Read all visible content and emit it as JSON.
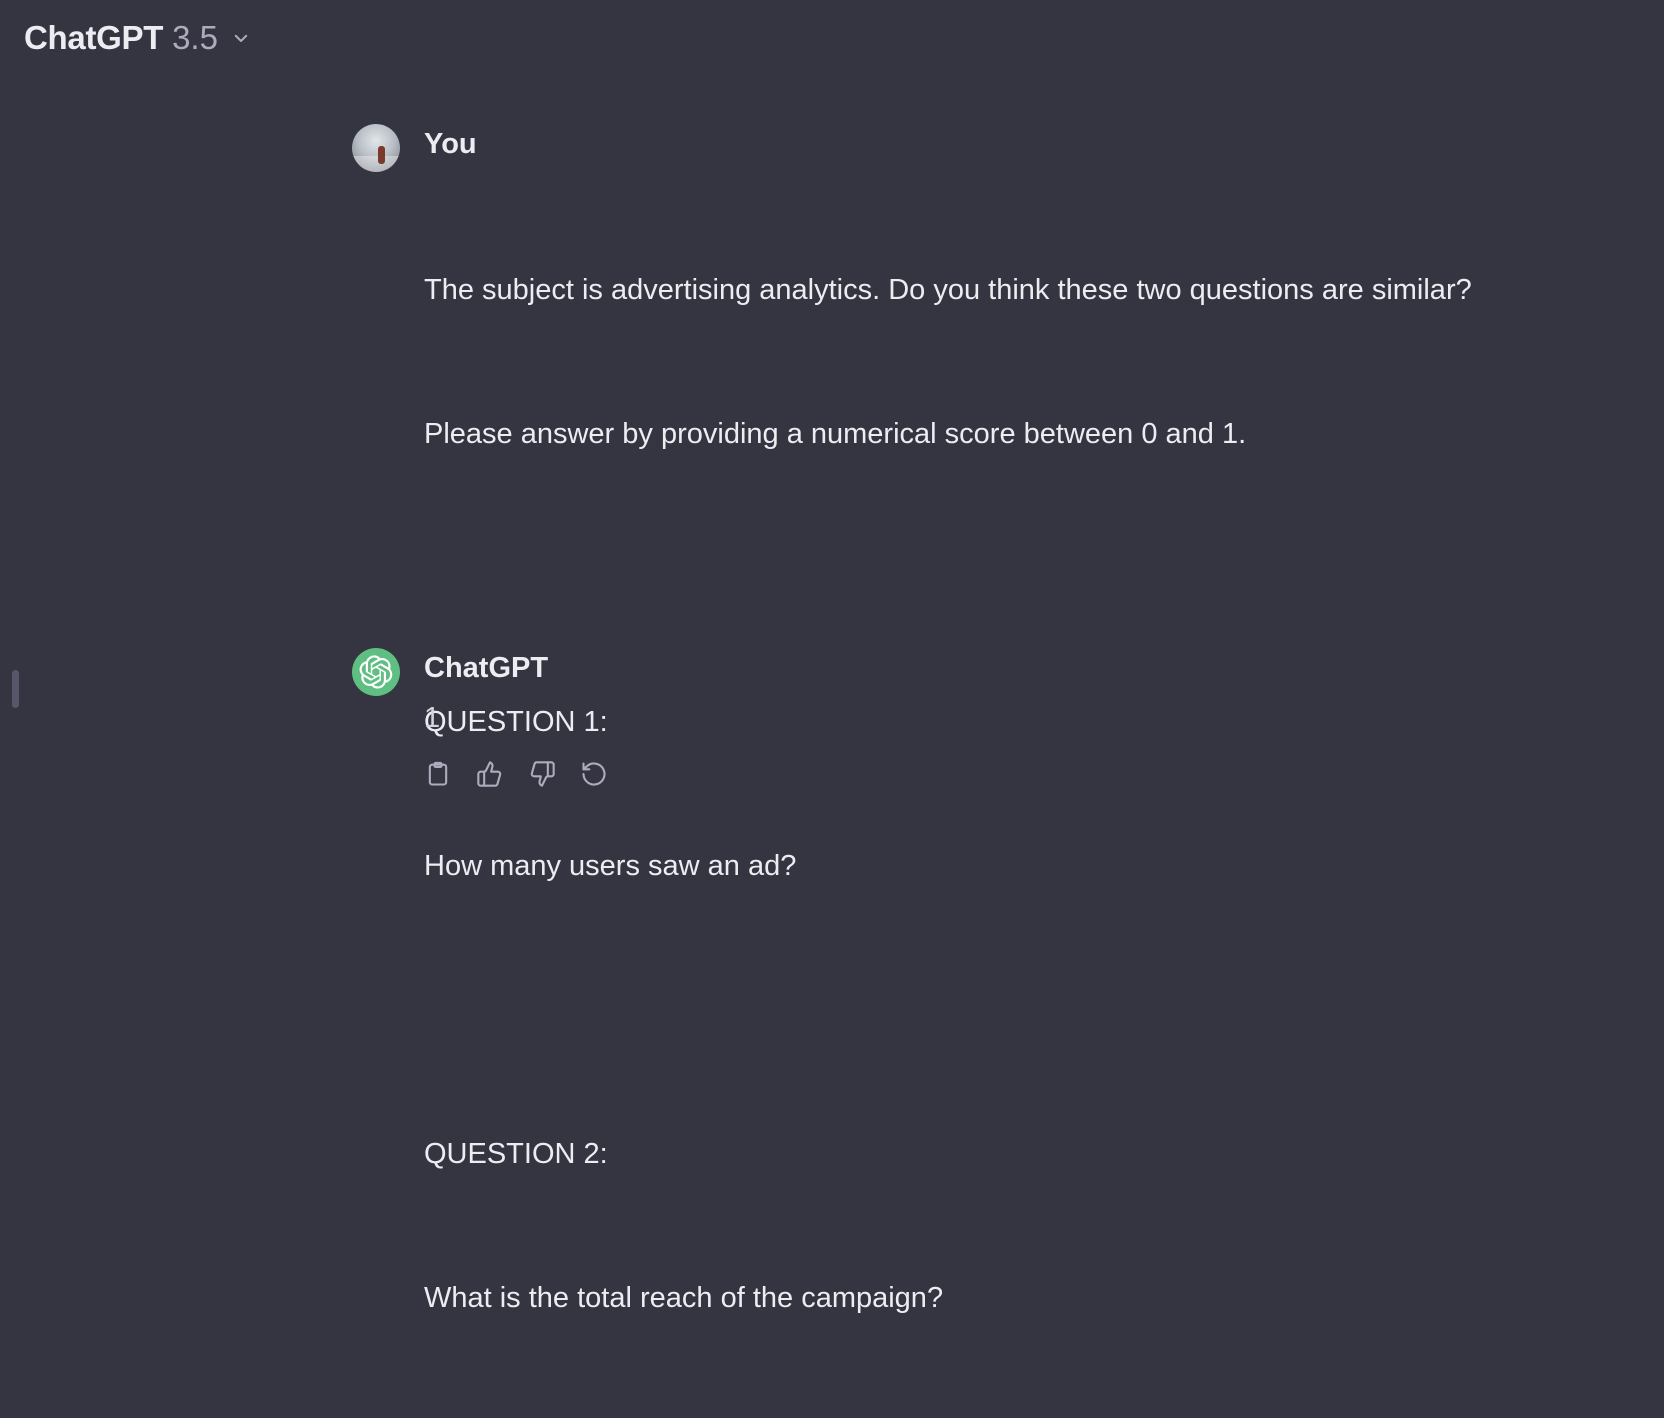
{
  "header": {
    "model_name": "ChatGPT",
    "model_version": "3.5"
  },
  "conversation": {
    "user_message": {
      "author": "You",
      "paragraphs": [
        "The subject is advertising analytics. Do you think these two questions are similar?",
        "Please answer by providing a numerical score between 0 and 1.",
        "QUESTION 1:",
        "How many users saw an ad?",
        "QUESTION 2:",
        "What is the total reach of the campaign?"
      ]
    },
    "assistant_message": {
      "author": "ChatGPT",
      "answer": "1"
    }
  },
  "actions": {
    "icons": [
      "clipboard-icon",
      "thumbs-up-icon",
      "thumbs-down-icon",
      "regenerate-icon"
    ]
  },
  "colors": {
    "background": "#343541",
    "text": "#ececf1",
    "muted": "#acacbe",
    "assistant_avatar": "#5fbf82"
  }
}
